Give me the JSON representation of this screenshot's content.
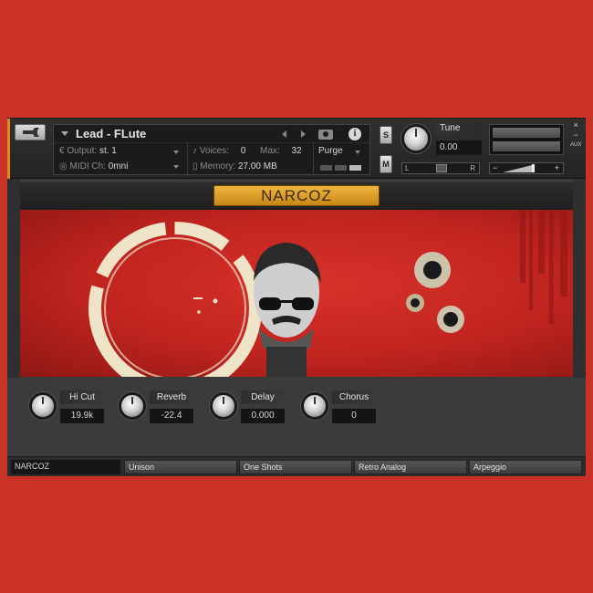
{
  "header": {
    "instrument_title": "Lead - FLute",
    "output_label": "Output:",
    "output_value": "st. 1",
    "midi_label": "MIDI Ch:",
    "midi_value": "0mni",
    "voices_label": "Voices:",
    "voices_value": "0",
    "max_label": "Max:",
    "max_value": "32",
    "memory_label": "Memory:",
    "memory_value": "27.00 MB",
    "purge_label": "Purge",
    "info_glyph": "i",
    "solo_label": "S",
    "mute_label": "M",
    "tune_label": "Tune",
    "tune_value": "0.00",
    "pan_left": "L",
    "pan_right": "R",
    "vol_minus": "−",
    "vol_plus": "+",
    "close_glyph": "×",
    "minimize_glyph": "−",
    "aux_label": "AUX"
  },
  "panel": {
    "title_button": "NARCOZ"
  },
  "knobs": [
    {
      "label": "Hi Cut",
      "value": "19.9k"
    },
    {
      "label": "Reverb",
      "value": "-22.4"
    },
    {
      "label": "Delay",
      "value": "0.000"
    },
    {
      "label": "Chorus",
      "value": "0"
    }
  ],
  "footer": {
    "preset_name": "NARCOZ",
    "tabs": [
      "Unison",
      "One Shots",
      "Retro Analog",
      "Arpeggio"
    ]
  },
  "colors": {
    "background": "#c93225",
    "accent_gold": "#e0a22e",
    "panel_dark": "#3a3a3a"
  }
}
